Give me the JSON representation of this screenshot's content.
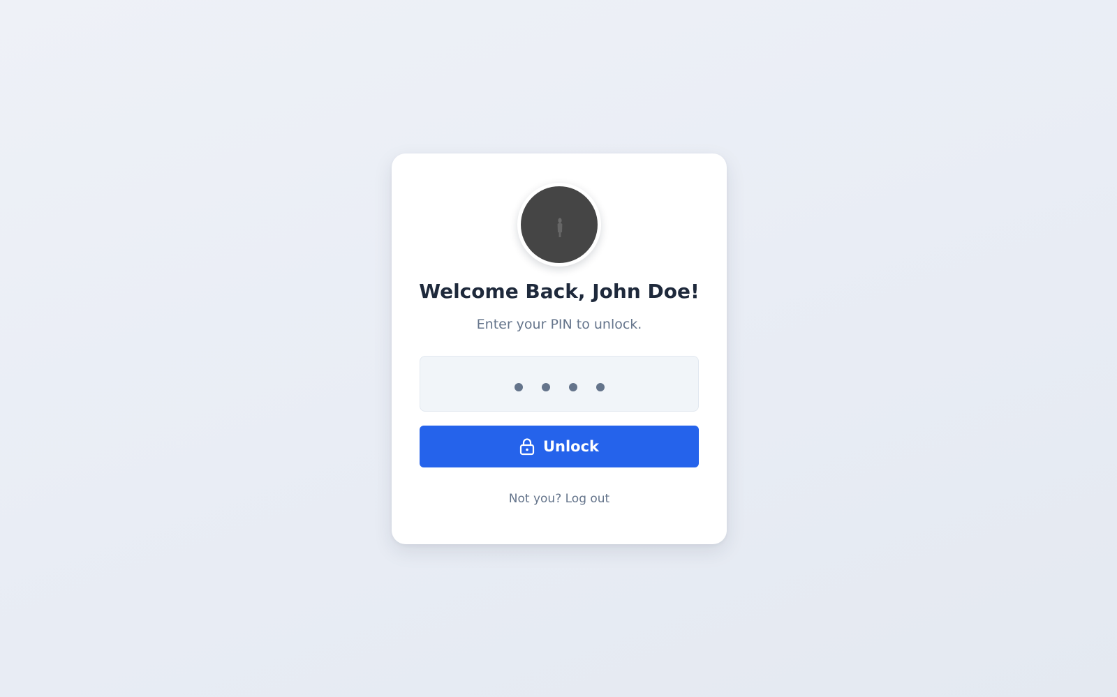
{
  "lock_screen": {
    "avatar_icon": "user-avatar-icon",
    "title": "Welcome Back, John Doe!",
    "subtitle": "Enter your PIN to unlock.",
    "pin": {
      "length": 4,
      "filled": 4,
      "dot_icon": "pin-dot"
    },
    "unlock_button": {
      "label": "Unlock",
      "icon": "lock-icon"
    },
    "logout_link": "Not you? Log out"
  },
  "colors": {
    "background": "#eceff5",
    "card": "#ffffff",
    "title": "#1e293b",
    "muted_text": "#64748b",
    "pin_field_bg": "#f1f5f9",
    "pin_dot": "#64748b",
    "primary": "#2563eb",
    "avatar": "#454545"
  }
}
